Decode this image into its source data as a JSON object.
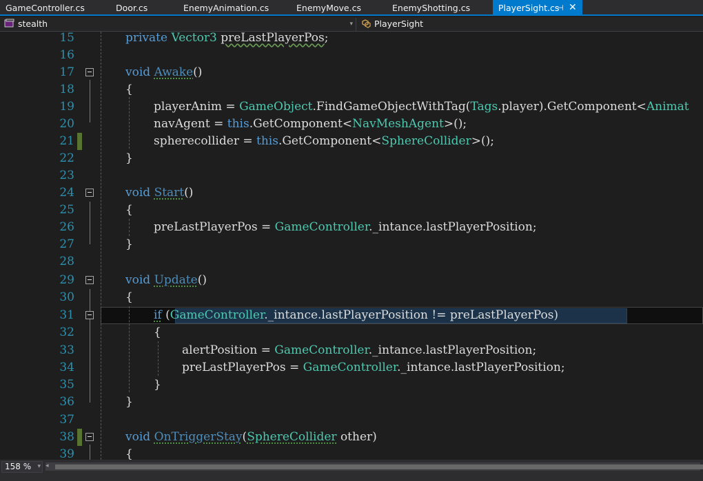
{
  "tabs": [
    {
      "label": "GameController.cs",
      "active": false
    },
    {
      "label": "Door.cs",
      "active": false
    },
    {
      "label": "EnemyAnimation.cs",
      "active": false
    },
    {
      "label": "EnemyMove.cs",
      "active": false
    },
    {
      "label": "EnemyShotting.cs",
      "active": false
    },
    {
      "label": "PlayerSight.cs",
      "active": true
    }
  ],
  "icons": {
    "pin": "pin-icon",
    "close": "close-icon",
    "project": "csharp-project-icon",
    "class": "class-icon",
    "fold": "collapse-minus-icon"
  },
  "active_tab_pin": "⊣",
  "active_tab_close": "✕",
  "nav": {
    "project": "stealth",
    "member": "PlayerSight"
  },
  "zoom": "158 %",
  "colors": {
    "accent": "#007acc",
    "keyword": "#569cd6",
    "type": "#4ec9b0",
    "line_number": "#2b91af",
    "change_marker": "#577430"
  },
  "lines": [
    {
      "n": "15",
      "code": "private Vector3 preLastPlayerPos;"
    },
    {
      "n": "16",
      "code": ""
    },
    {
      "n": "17",
      "code": "void Awake()"
    },
    {
      "n": "18",
      "code": "{"
    },
    {
      "n": "19",
      "code": "playerAnim = GameObject.FindGameObjectWithTag(Tags.player).GetComponent<Animat"
    },
    {
      "n": "20",
      "code": "navAgent = this.GetComponent<NavMeshAgent>();"
    },
    {
      "n": "21",
      "code": "spherecollider = this.GetComponent<SphereCollider>();"
    },
    {
      "n": "22",
      "code": "}"
    },
    {
      "n": "23",
      "code": ""
    },
    {
      "n": "24",
      "code": "void Start()"
    },
    {
      "n": "25",
      "code": "{"
    },
    {
      "n": "26",
      "code": "preLastPlayerPos = GameController._intance.lastPlayerPosition;"
    },
    {
      "n": "27",
      "code": "}"
    },
    {
      "n": "28",
      "code": ""
    },
    {
      "n": "29",
      "code": "void Update()"
    },
    {
      "n": "30",
      "code": "{"
    },
    {
      "n": "31",
      "code": "if (GameController._intance.lastPlayerPosition != preLastPlayerPos)"
    },
    {
      "n": "32",
      "code": "{"
    },
    {
      "n": "33",
      "code": "alertPosition = GameController._intance.lastPlayerPosition;"
    },
    {
      "n": "34",
      "code": "preLastPlayerPos = GameController._intance.lastPlayerPosition;"
    },
    {
      "n": "35",
      "code": "}"
    },
    {
      "n": "36",
      "code": "}"
    },
    {
      "n": "37",
      "code": ""
    },
    {
      "n": "38",
      "code": "void OnTriggerStay(SphereCollider other)"
    },
    {
      "n": "39",
      "code": "{"
    }
  ],
  "tokens": {
    "l15": [
      "private",
      " ",
      "Vector3",
      " ",
      "preLastPlayerPos",
      ";"
    ],
    "l17": [
      "void",
      " ",
      "Awake",
      "()"
    ],
    "l19": [
      "playerAnim = ",
      "GameObject",
      ".FindGameObjectWithTag(",
      "Tags",
      ".player).GetComponent<",
      "Animat"
    ],
    "l20": [
      "navAgent = ",
      "this",
      ".GetComponent<",
      "NavMeshAgent",
      ">();"
    ],
    "l21": [
      "spherecollider = ",
      "this",
      ".GetComponent<",
      "SphereCollider",
      ">();"
    ],
    "l24": [
      "void",
      " ",
      "Start",
      "()"
    ],
    "l26": [
      "preLastPlayerPos = ",
      "GameController",
      "._intance.lastPlayerPosition;"
    ],
    "l29": [
      "void",
      " ",
      "Update",
      "()"
    ],
    "l31": [
      "if",
      " (",
      "GameController",
      "._intance.lastPlayerPosition != preLastPlayerPos)"
    ],
    "l33": [
      "alertPosition = ",
      "GameController",
      "._intance.lastPlayerPosition;"
    ],
    "l34": [
      "preLastPlayerPos = ",
      "GameController",
      "._intance.lastPlayerPosition;"
    ],
    "l38": [
      "void",
      " ",
      "OnTriggerStay",
      "(",
      "SphereCollider",
      " other)"
    ],
    "brace_open": "{",
    "brace_close": "}"
  }
}
